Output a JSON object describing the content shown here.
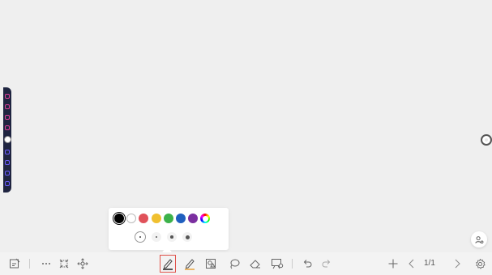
{
  "colors": {
    "canvas_bg": "#efefef",
    "toolbar_bg": "#f3f3f3",
    "dock_bg": "#1f2440",
    "active_outline": "#e0524a",
    "pen_underline": "#e6a23c"
  },
  "left_dock": {
    "icons": [
      {
        "name": "tool-icon-1",
        "color": "#e0409a"
      },
      {
        "name": "tool-icon-2",
        "color": "#e0409a"
      },
      {
        "name": "tool-icon-3",
        "color": "#e0409a"
      },
      {
        "name": "tool-icon-4",
        "color": "#e0409a"
      },
      {
        "name": "tool-icon-5",
        "color": "#6b5cff"
      },
      {
        "name": "tool-icon-6",
        "color": "#6b5cff"
      },
      {
        "name": "tool-icon-7",
        "color": "#6b5cff"
      },
      {
        "name": "tool-icon-8",
        "color": "#6b5cff"
      }
    ]
  },
  "pen_popover": {
    "colors": [
      {
        "name": "color-black",
        "hex": "#000000",
        "selected": true
      },
      {
        "name": "color-white",
        "hex": "#ffffff"
      },
      {
        "name": "color-red",
        "hex": "#e0525a"
      },
      {
        "name": "color-yellow",
        "hex": "#f0c030"
      },
      {
        "name": "color-green",
        "hex": "#3cb24a"
      },
      {
        "name": "color-blue",
        "hex": "#1f5fbf"
      },
      {
        "name": "color-purple",
        "hex": "#7b2fa0"
      },
      {
        "name": "color-custom-rainbow",
        "hex": "rainbow"
      }
    ],
    "sizes": [
      {
        "name": "stroke-size-1",
        "dot": 1,
        "selected": true
      },
      {
        "name": "stroke-size-2",
        "dot": 2
      },
      {
        "name": "stroke-size-3",
        "dot": 3
      },
      {
        "name": "stroke-size-4",
        "dot": 5
      }
    ]
  },
  "toolbar": {
    "page_indicator": "1/1",
    "icons": [
      "whiteboard-menu-icon",
      "more-icon",
      "select-icon",
      "move-icon",
      "pen-icon",
      "highlighter-icon",
      "shape-icon",
      "lasso-icon",
      "eraser-icon",
      "insert-icon",
      "undo-icon",
      "redo-icon",
      "add-page-icon",
      "prev-page-icon",
      "next-page-icon",
      "settings-icon"
    ]
  }
}
